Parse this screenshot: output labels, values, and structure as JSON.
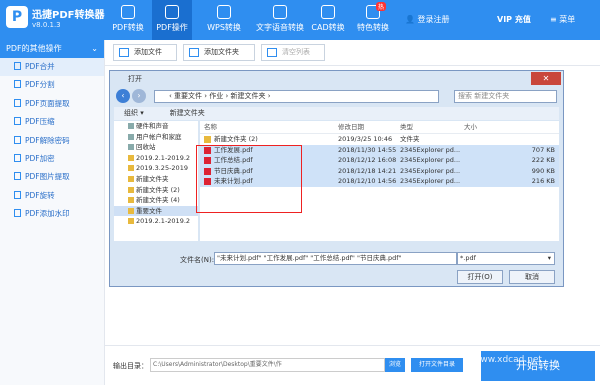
{
  "app": {
    "name": "迅捷PDF转换器",
    "version": "v8.0.1.3",
    "logo_glyph": "P"
  },
  "nav": [
    {
      "label": "PDF转换",
      "icon": "refresh-icon"
    },
    {
      "label": "PDF操作",
      "icon": "gear-icon"
    },
    {
      "label": "WPS转换",
      "icon": "w-icon"
    },
    {
      "label": "文字语音转换",
      "icon": "audio-icon"
    },
    {
      "label": "CAD转换",
      "icon": "cad-icon"
    },
    {
      "label": "特色转换",
      "icon": "grid-icon",
      "badge": "热"
    }
  ],
  "topright": {
    "login": "登录注册",
    "vip": "VIP 充值",
    "menu": "菜单"
  },
  "sidebar": {
    "header": "PDF的其他操作",
    "items": [
      "PDF合并",
      "PDF分割",
      "PDF页面提取",
      "PDF压缩",
      "PDF解除密码",
      "PDF加密",
      "PDF图片提取",
      "PDF旋转",
      "PDF添加水印"
    ]
  },
  "toolbar": {
    "add_file": "添加文件",
    "add_folder": "添加文件夹",
    "clear": "清空列表"
  },
  "dialog": {
    "title": "打开",
    "close": "✕",
    "path": "‹ 重要文件 › 作业 › 新建文件夹 ›",
    "search_placeholder": "搜索 新建文件夹",
    "organize": "组织 ▾",
    "new_folder": "新建文件夹",
    "tree": [
      {
        "label": "硬件和声音",
        "folder": false
      },
      {
        "label": "用户帐户和家庭",
        "folder": false
      },
      {
        "label": "回收站",
        "folder": false
      },
      {
        "label": "2019.2.1-2019.2",
        "folder": true
      },
      {
        "label": "2019.3.25-2019",
        "folder": true
      },
      {
        "label": "新建文件夹",
        "folder": true
      },
      {
        "label": "新建文件夹 (2)",
        "folder": true
      },
      {
        "label": "新建文件夹 (4)",
        "folder": true
      },
      {
        "label": "重要文件",
        "folder": true,
        "selected": true
      },
      {
        "label": "2019.2.1-2019.2",
        "folder": true
      }
    ],
    "columns": {
      "name": "名称",
      "date": "修改日期",
      "type": "类型",
      "size": "大小"
    },
    "files": [
      {
        "name": "新建文件夹 (2)",
        "date": "2019/3/25 10:46",
        "type": "文件夹",
        "size": "",
        "folder": true,
        "selected": false
      },
      {
        "name": "工作发展.pdf",
        "date": "2018/11/30 14:55",
        "type": "2345Explorer pd...",
        "size": "707 KB",
        "folder": false,
        "selected": true
      },
      {
        "name": "工作总结.pdf",
        "date": "2018/12/12 16:08",
        "type": "2345Explorer pd...",
        "size": "222 KB",
        "folder": false,
        "selected": true
      },
      {
        "name": "节日庆典.pdf",
        "date": "2018/12/18 14:21",
        "type": "2345Explorer pd...",
        "size": "990 KB",
        "folder": false,
        "selected": true
      },
      {
        "name": "未来计划.pdf",
        "date": "2018/12/10 14:56",
        "type": "2345Explorer pd...",
        "size": "216 KB",
        "folder": false,
        "selected": true
      }
    ],
    "filename_label": "文件名(N):",
    "filename_value": "\"未来计划.pdf\" \"工作发展.pdf\" \"工作总结.pdf\" \"节日庆典.pdf\"",
    "filetype": "*.pdf",
    "open": "打开(O)",
    "cancel": "取消"
  },
  "bottom": {
    "output_label": "输出目录：",
    "output_path": "C:\\Users\\Administrator\\Desktop\\重要文件\\作",
    "browse": "浏览",
    "open_output": "打开文件目录",
    "start": "开始转换"
  },
  "watermark": "www.xdcad.net",
  "colors": {
    "brand": "#2f8ef0",
    "selection_box": "#ee2222"
  }
}
